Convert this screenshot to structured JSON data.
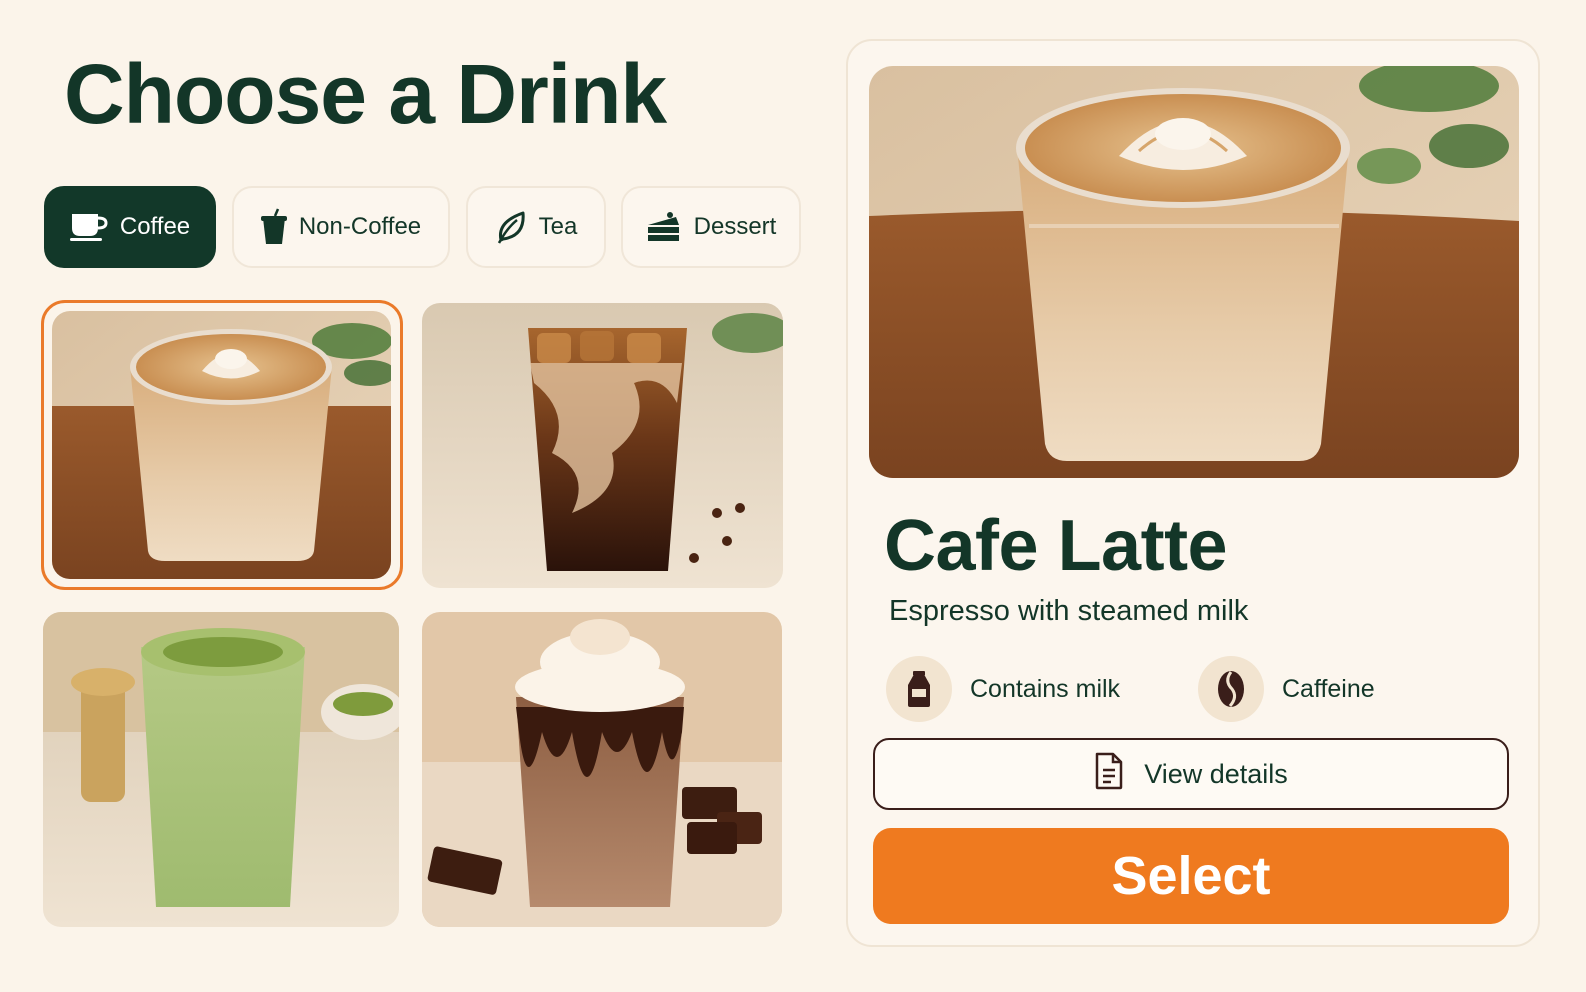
{
  "page": {
    "title": "Choose a Drink"
  },
  "tabs": [
    {
      "label": "Coffee",
      "icon": "coffee-cup-icon",
      "active": true
    },
    {
      "label": "Non-Coffee",
      "icon": "takeaway-cup-icon",
      "active": false
    },
    {
      "label": "Tea",
      "icon": "leaf-icon",
      "active": false
    },
    {
      "label": "Dessert",
      "icon": "cake-slice-icon",
      "active": false
    }
  ],
  "drinks": [
    {
      "id": "cafe-latte",
      "image": "latte-photo",
      "selected": true
    },
    {
      "id": "iced-latte",
      "image": "iced-coffee-photo",
      "selected": false
    },
    {
      "id": "matcha-latte",
      "image": "matcha-photo",
      "selected": false
    },
    {
      "id": "mocha-frappe",
      "image": "mocha-frappe-photo",
      "selected": false
    }
  ],
  "detail": {
    "name": "Cafe Latte",
    "description": "Espresso with steamed milk",
    "tags": [
      {
        "label": "Contains milk",
        "icon": "milk-bottle-icon"
      },
      {
        "label": "Caffeine",
        "icon": "coffee-bean-icon"
      }
    ],
    "view_details_label": "View details",
    "select_label": "Select"
  },
  "colors": {
    "background": "#fbf4ea",
    "primary_dark": "#123829",
    "accent_orange": "#ef7a1f",
    "selection_border": "#ea7a2a"
  }
}
